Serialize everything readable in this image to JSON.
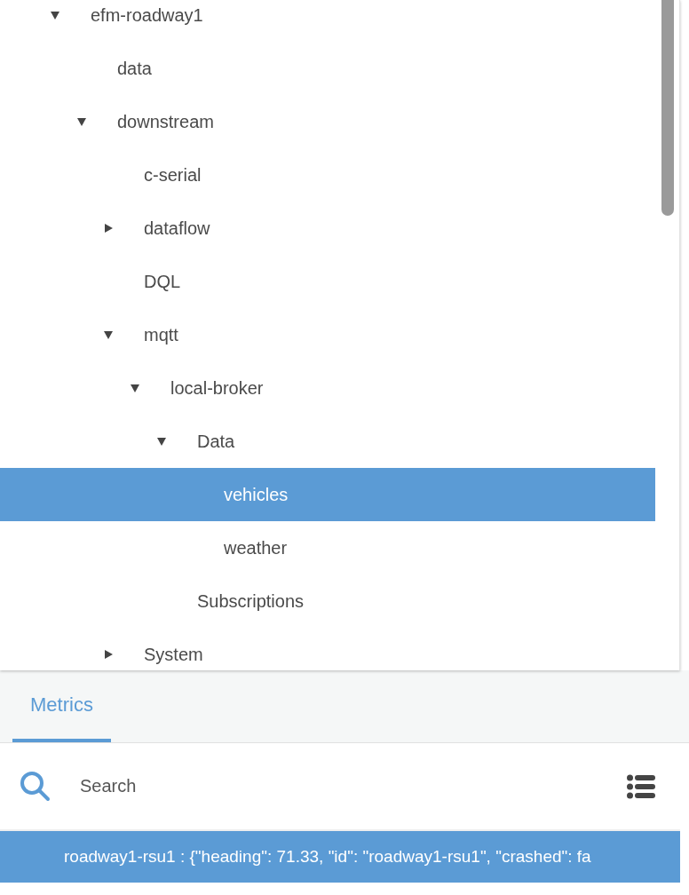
{
  "tree": [
    {
      "label": "efm-roadway1",
      "kind": "branch",
      "expanded": true,
      "selected": false,
      "children": [
        {
          "label": "data",
          "kind": "leaf",
          "selected": false
        },
        {
          "label": "downstream",
          "kind": "branch",
          "expanded": true,
          "selected": false,
          "children": [
            {
              "label": "c-serial",
              "kind": "leaf",
              "selected": false
            },
            {
              "label": "dataflow",
              "kind": "branch",
              "expanded": false,
              "selected": false
            },
            {
              "label": "DQL",
              "kind": "leaf",
              "selected": false
            },
            {
              "label": "mqtt",
              "kind": "branch",
              "expanded": true,
              "selected": false,
              "children": [
                {
                  "label": "local-broker",
                  "kind": "branch",
                  "expanded": true,
                  "selected": false,
                  "children": [
                    {
                      "label": "Data",
                      "kind": "branch",
                      "expanded": true,
                      "selected": false,
                      "children": [
                        {
                          "label": "vehicles",
                          "kind": "leaf",
                          "selected": true
                        },
                        {
                          "label": "weather",
                          "kind": "leaf",
                          "selected": false
                        }
                      ]
                    },
                    {
                      "label": "Subscriptions",
                      "kind": "leaf",
                      "selected": false
                    }
                  ]
                }
              ]
            },
            {
              "label": "System",
              "kind": "branch",
              "expanded": false,
              "selected": false
            }
          ]
        }
      ]
    }
  ],
  "tabs": [
    {
      "label": "Metrics",
      "selected": true
    }
  ],
  "search": {
    "placeholder": "Search"
  },
  "metrics": [
    {
      "text": "roadway1-rsu1 : {\"heading\": 71.33, \"id\": \"roadway1-rsu1\", \"crashed\": fa",
      "selected": true
    }
  ]
}
